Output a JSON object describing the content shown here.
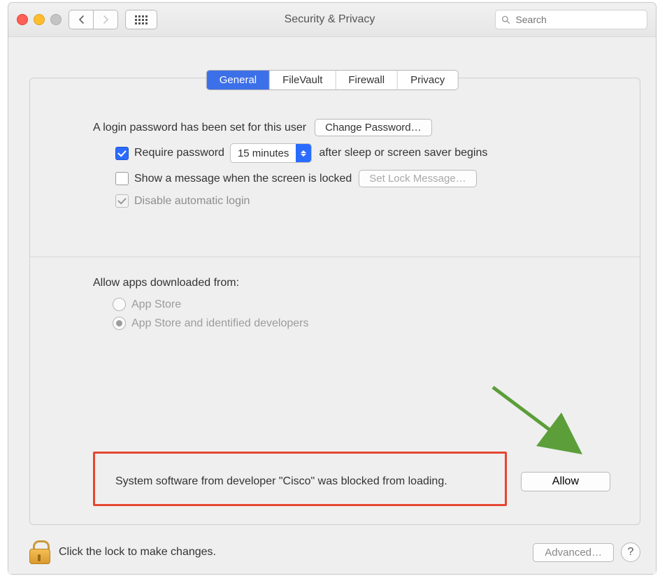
{
  "window": {
    "title": "Security & Privacy",
    "search_placeholder": "Search"
  },
  "tabs": {
    "general": "General",
    "filevault": "FileVault",
    "firewall": "Firewall",
    "privacy": "Privacy"
  },
  "general": {
    "login_set_label": "A login password has been set for this user",
    "change_password_btn": "Change Password…",
    "require_password_label": "Require password",
    "require_password_delay": "15 minutes",
    "require_password_suffix": "after sleep or screen saver begins",
    "show_message_label": "Show a message when the screen is locked",
    "set_lock_message_btn": "Set Lock Message…",
    "disable_auto_login_label": "Disable automatic login",
    "allow_apps_label": "Allow apps downloaded from:",
    "radio_app_store": "App Store",
    "radio_identified": "App Store and identified developers",
    "blocked_message": "System software from developer \"Cisco\" was blocked from loading.",
    "allow_btn": "Allow"
  },
  "footer": {
    "lock_text": "Click the lock to make changes.",
    "advanced_btn": "Advanced…",
    "help_btn": "?"
  }
}
